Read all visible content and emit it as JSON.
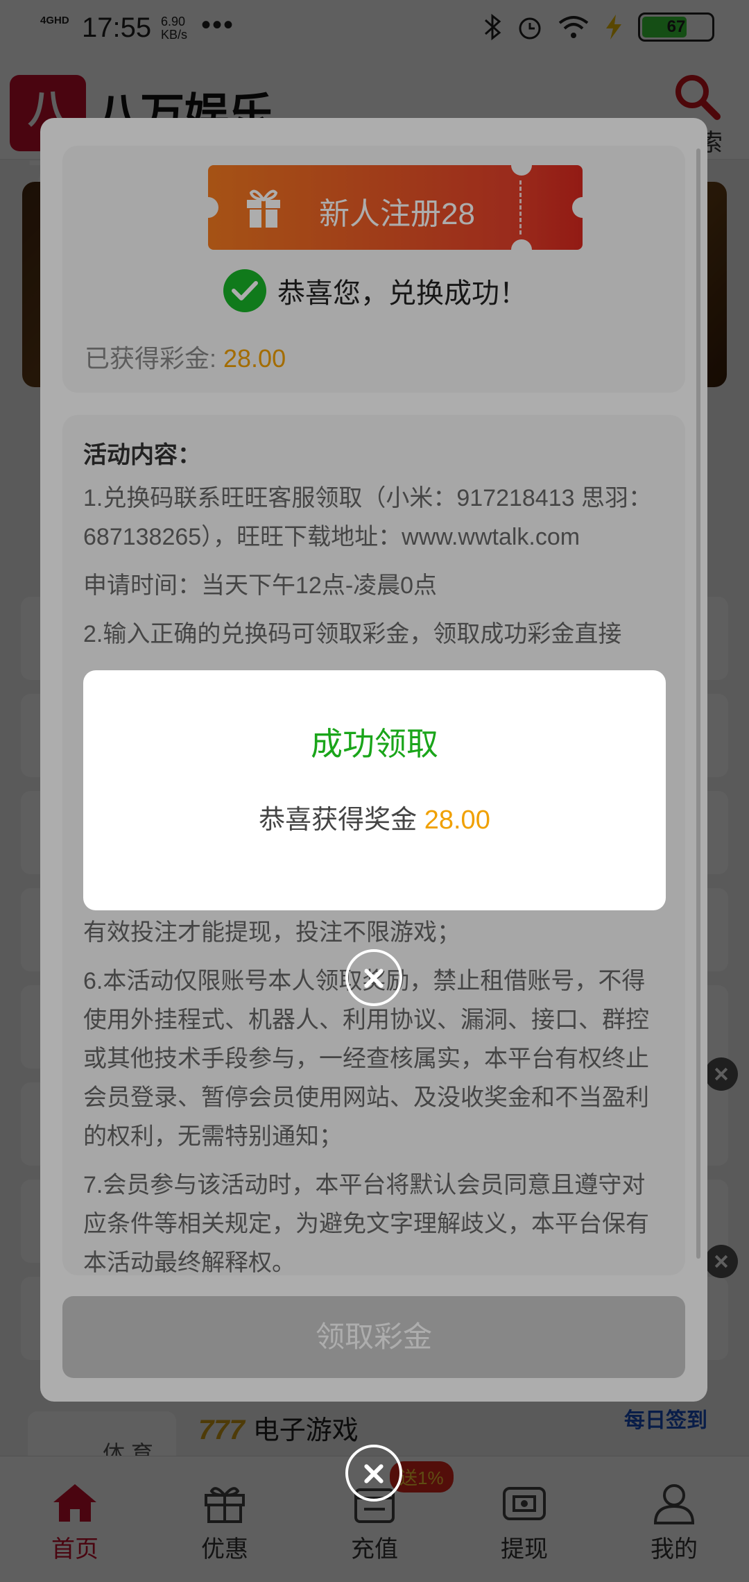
{
  "status_bar": {
    "network": "4GHD",
    "time": "17:55",
    "speed_value": "6.90",
    "speed_unit": "KB/s",
    "more": "•••",
    "battery": "67"
  },
  "app": {
    "logo_glyph": "八万",
    "title": "八万娱乐",
    "search_label": "索"
  },
  "background_page": {
    "game_label": "电子游戏",
    "game_logo": "777",
    "daily_sign": "每日签到",
    "sports_tab": "体 育"
  },
  "bottom_nav": {
    "items": [
      {
        "label": "首页",
        "icon": "home-icon"
      },
      {
        "label": "优惠",
        "icon": "gift-icon"
      },
      {
        "label": "充值",
        "icon": "wallet-icon"
      },
      {
        "label": "提现",
        "icon": "withdraw-icon"
      },
      {
        "label": "我的",
        "icon": "user-icon"
      }
    ],
    "recharge_badge": "送1%"
  },
  "activity": {
    "ticket_label": "新人注册28",
    "success_text": "恭喜您，兑换成功！",
    "obtained_label": "已获得彩金: ",
    "obtained_amount": "28.00",
    "content_heading": "活动内容：",
    "content": [
      "1.兑换码联系旺旺客服领取（小米：917218413 思羽：687138265），旺旺下载地址：www.wwtalk.com",
      "申请时间：当天下午12点-凌晨0点",
      "2.输入正确的兑换码可领取彩金，领取成功彩金直接"
    ],
    "content_after": [
      "有效投注才能提现，投注不限游戏；",
      "6.本活动仅限账号本人领取奖励，禁止租借账号，不得使用外挂程式、机器人、利用协议、漏洞、接口、群控或其他技术手段参与，一经查核属实，本平台有权终止会员登录、暂停会员使用网站、及没收奖金和不当盈利的权利，无需特别通知；",
      "7.会员参与该活动时，本平台将默认会员同意且遵守对应条件等相关规定，为避免文字理解歧义，本平台保有本活动最终解释权。"
    ],
    "claim_button": "领取彩金"
  },
  "dialog": {
    "title": "成功领取",
    "message": "恭喜获得奖金 ",
    "amount": "28.00"
  },
  "colors": {
    "brand_red": "#c8102e",
    "success_green": "#1aa51a",
    "amount_orange": "#f0a000",
    "ticket_orange": "#f47a20"
  }
}
